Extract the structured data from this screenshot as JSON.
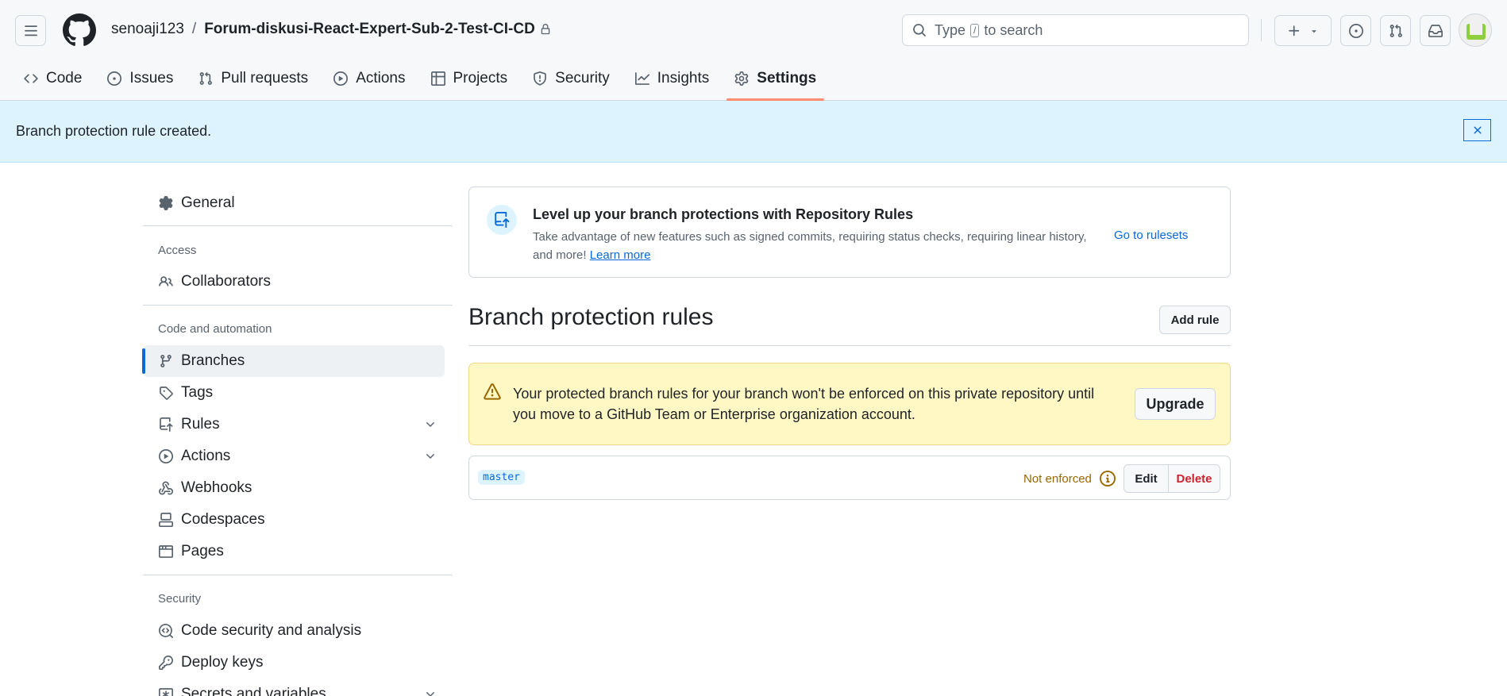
{
  "header": {
    "owner": "senoaji123",
    "separator": "/",
    "repo": "Forum-diskusi-React-Expert-Sub-2-Test-CI-CD",
    "search": {
      "prefix": "Type",
      "key": "/",
      "suffix": "to search"
    },
    "icons": [
      "hamburger-icon",
      "github-logo-icon",
      "lock-icon",
      "search-icon",
      "plus-icon",
      "chevron-down-icon",
      "issue-opened-icon",
      "pull-request-icon",
      "inbox-icon",
      "avatar"
    ]
  },
  "tabs": [
    {
      "label": "Code",
      "icon": "code-icon"
    },
    {
      "label": "Issues",
      "icon": "issue-opened-icon"
    },
    {
      "label": "Pull requests",
      "icon": "pull-request-icon"
    },
    {
      "label": "Actions",
      "icon": "play-icon"
    },
    {
      "label": "Projects",
      "icon": "table-icon"
    },
    {
      "label": "Security",
      "icon": "shield-icon"
    },
    {
      "label": "Insights",
      "icon": "graph-icon"
    },
    {
      "label": "Settings",
      "icon": "gear-icon",
      "active": true
    }
  ],
  "flash": {
    "message": "Branch protection rule created."
  },
  "sidebar": {
    "general": "General",
    "access_heading": "Access",
    "collaborators": "Collaborators",
    "code_heading": "Code and automation",
    "branches": "Branches",
    "tags": "Tags",
    "rules": "Rules",
    "actions": "Actions",
    "webhooks": "Webhooks",
    "codespaces": "Codespaces",
    "pages": "Pages",
    "security_heading": "Security",
    "code_security": "Code security and analysis",
    "deploy_keys": "Deploy keys",
    "secrets": "Secrets and variables"
  },
  "promo": {
    "title": "Level up your branch protections with Repository Rules",
    "description": "Take advantage of new features such as signed commits, requiring status checks, requiring linear history, and more!",
    "learn_more": "Learn more",
    "go_link": "Go to rulesets"
  },
  "main": {
    "title": "Branch protection rules",
    "add_rule": "Add rule"
  },
  "warning": {
    "text": "Your protected branch rules for your branch won't be enforced on this private repository until you move to a GitHub Team or Enterprise organization account.",
    "upgrade": "Upgrade"
  },
  "rule": {
    "branch": "master",
    "status": "Not enforced",
    "edit": "Edit",
    "delete": "Delete"
  },
  "colors": {
    "accent": "#0969da",
    "active_tab_underline": "#fd8c73",
    "flash_bg": "#ddf4ff",
    "warning_bg": "#fff8c5",
    "danger": "#cf222e",
    "attention": "#9a6700"
  }
}
